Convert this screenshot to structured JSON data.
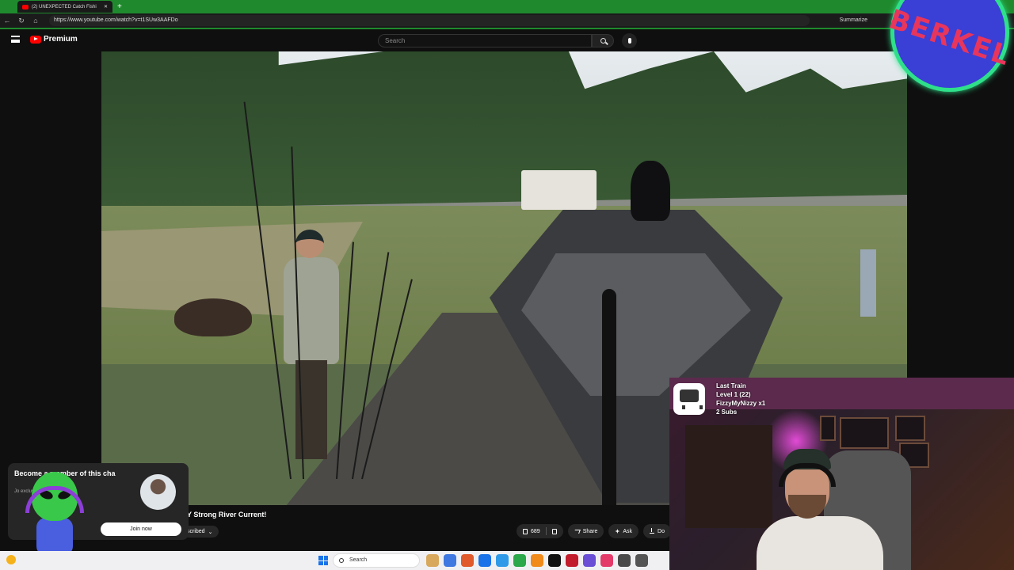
{
  "browser": {
    "tab_title": "(2) UNEXPECTED Catch Fishi",
    "url": "https://www.youtube.com/watch?v=t1SUw3AAFDo",
    "summarize_label": "Summarize"
  },
  "youtube": {
    "logo_label": "Premium",
    "search_placeholder": "Search",
    "video_title_visible": "Y Strong River Current!",
    "subscribe_label": "scribed",
    "like_count": "689",
    "share_label": "Share",
    "ask_label": "Ask",
    "download_label": "Do"
  },
  "membership": {
    "title": "Become a member of this cha",
    "subtitle": "Jo      exclusive perks",
    "join_label": "Join now"
  },
  "stream_alert": {
    "line1": "Last Train",
    "line2": "Level 1  (22)",
    "line3": "FizzyMyNizzy x1",
    "line4": "2 Subs"
  },
  "overlay_logo_text": "BERKEL",
  "taskbar": {
    "search_label": "Search",
    "icon_colors": [
      "#d8a85c",
      "#3f78e0",
      "#e05a2c",
      "#1a73e8",
      "#2f9be8",
      "#2aa84a",
      "#f08a1b",
      "#111111",
      "#c21b2b",
      "#6a4fd6",
      "#e33a6a",
      "#4a4a4a",
      "#555555"
    ]
  }
}
